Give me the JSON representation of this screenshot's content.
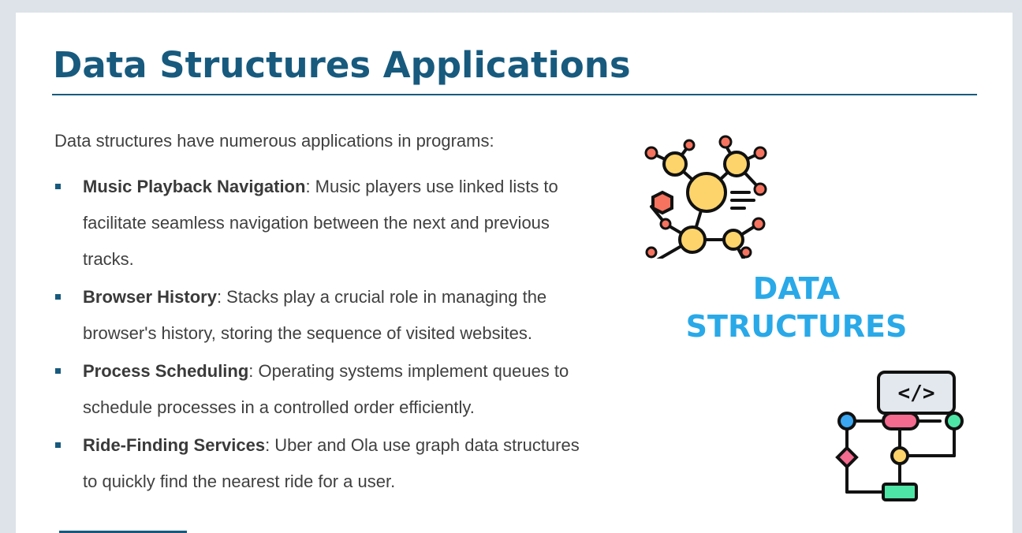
{
  "slide": {
    "title": "Data Structures Applications",
    "intro": "Data structures have numerous applications in programs:",
    "bullets": [
      {
        "term": "Music Playback Navigation",
        "text": ": Music players use linked lists to facilitate seamless navigation between the next and previous tracks."
      },
      {
        "term": "Browser History",
        "text": ": Stacks play a crucial role in managing the browser's history, storing the sequence of visited websites."
      },
      {
        "term": "Process Scheduling",
        "text": ": Operating systems implement queues to schedule processes in a controlled order efficiently."
      },
      {
        "term": "Ride-Finding Services",
        "text": ": Uber and Ola use graph data structures to quickly find the nearest ride for a user."
      }
    ],
    "graphic_label_line1": "DATA",
    "graphic_label_line2": "STRUCTURES",
    "code_icon_label": "</>"
  },
  "colors": {
    "title": "#175a7e",
    "body_text": "#404040",
    "bullet_marker": "#175a7e",
    "graphic_label": "#29a9e8",
    "node_yellow": "#fdd46b",
    "node_red": "#f5735f",
    "node_pink": "#f46b8f",
    "node_green": "#4ee6a6",
    "node_blue": "#3aa7f0"
  },
  "icons": {
    "network": "network-graph-icon",
    "flowchart": "code-flowchart-icon"
  }
}
